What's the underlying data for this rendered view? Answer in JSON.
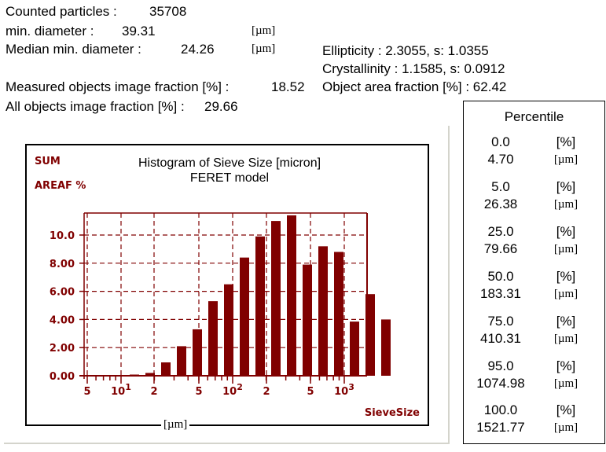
{
  "stats": {
    "counted_particles_label": "Counted particles :",
    "counted_particles_value": "35708",
    "min_diameter_label": "min. diameter :",
    "min_diameter_value": "39.31",
    "min_diameter_unit": "[µm]",
    "median_min_diameter_label": "Median  min. diameter :",
    "median_min_diameter_value": "24.26",
    "median_min_diameter_unit": "[µm]",
    "ellipticity": "Ellipticity : 2.3055, s: 1.0355",
    "crystallinity": "Crystallinity : 1.1585, s: 0.0912",
    "measured_fraction_label": "Measured objects image fraction [%] :",
    "measured_fraction_value": "18.52",
    "object_area_fraction": "Object area fraction [%] :  62.42",
    "all_fraction_label": "All objects image fraction [%] :",
    "all_fraction_value": "29.66"
  },
  "percentile": {
    "title": "Percentile",
    "percent_unit": "[%]",
    "size_unit": "[µm]",
    "rows": [
      {
        "percent": "0.0",
        "size": "4.70"
      },
      {
        "percent": "5.0",
        "size": "26.38"
      },
      {
        "percent": "25.0",
        "size": "79.66"
      },
      {
        "percent": "50.0",
        "size": "183.31"
      },
      {
        "percent": "75.0",
        "size": "410.31"
      },
      {
        "percent": "95.0",
        "size": "1074.98"
      },
      {
        "percent": "100.0",
        "size": "1521.77"
      }
    ]
  },
  "colors": {
    "bar": "#800000",
    "grid": "#800000"
  },
  "chart_data": {
    "type": "bar",
    "title": "Histogram of Sieve Size [micron]",
    "subtitle": "FERET model",
    "corner_labels": [
      "SUM",
      "AREAF %"
    ],
    "xlabel": "SieveSize",
    "xunit": "[µm]",
    "x_scale": "log",
    "xlim": [
      4.7,
      1600
    ],
    "ylim": [
      0,
      11.4
    ],
    "grid": true,
    "y_ticks": [
      {
        "value": 0,
        "label": "0.00"
      },
      {
        "value": 2,
        "label": "2.00"
      },
      {
        "value": 4,
        "label": "4.00"
      },
      {
        "value": 6,
        "label": "6.00"
      },
      {
        "value": 8,
        "label": "8.00"
      },
      {
        "value": 10,
        "label": "10.0"
      }
    ],
    "x_ticks": [
      {
        "value": 5,
        "label": "5"
      },
      {
        "value": 10,
        "label": "10",
        "sup": "1"
      },
      {
        "value": 20,
        "label": "2"
      },
      {
        "value": 50,
        "label": "5"
      },
      {
        "value": 100,
        "label": "10",
        "sup": "2"
      },
      {
        "value": 200,
        "label": "2"
      },
      {
        "value": 500,
        "label": "5"
      },
      {
        "value": 1000,
        "label": "10",
        "sup": "3"
      }
    ],
    "bin_centers": [
      5.6,
      7.1,
      8.9,
      11.2,
      14.1,
      17.8,
      22.4,
      28.2,
      35.5,
      44.7,
      56.2,
      70.8,
      89.1,
      112,
      141,
      178,
      224,
      282,
      355,
      447,
      562,
      708,
      891,
      1122,
      1413
    ],
    "values": [
      0,
      0,
      0.03,
      0.2,
      0.95,
      2.1,
      3.3,
      5.3,
      6.5,
      8.4,
      9.9,
      11.0,
      11.4,
      7.9,
      9.2,
      8.8,
      3.85,
      5.8,
      4.0
    ]
  }
}
